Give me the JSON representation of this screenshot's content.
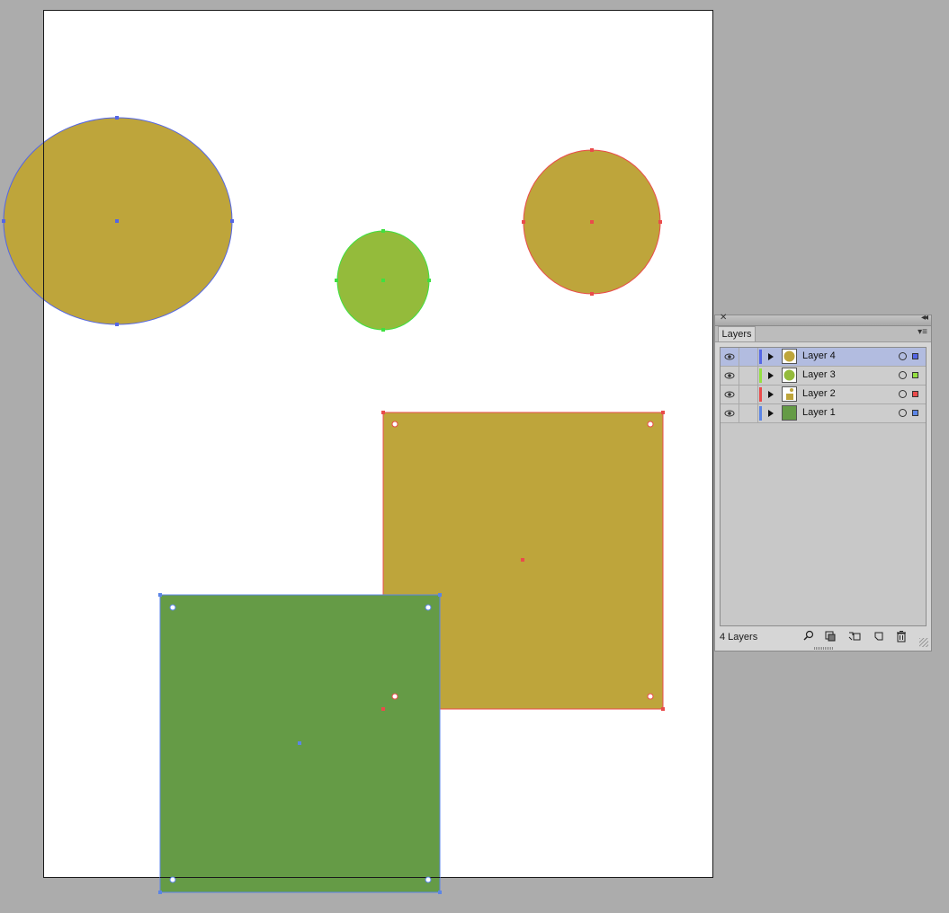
{
  "artwork": {
    "colors": {
      "mustard": "#bea53b",
      "lime": "#94bb3b",
      "green": "#659b46",
      "blue_handle": "#5466e6",
      "green_handle": "#40e040",
      "red_handle": "#ea4b4b",
      "steel_handle": "#5b85e6"
    }
  },
  "layers_panel": {
    "tab_label": "Layers",
    "close_glyph": "✕",
    "collapse_glyph": "◂◂",
    "menu_glyph": "▾≡",
    "layers": [
      {
        "name": "Layer 4",
        "color": "#5466e6",
        "thumb": "circle-mustard",
        "selected": true
      },
      {
        "name": "Layer 3",
        "color": "#94e040",
        "thumb": "circle-lime",
        "selected": false
      },
      {
        "name": "Layer 2",
        "color": "#ea4b4b",
        "thumb": "square-mustard",
        "selected": false
      },
      {
        "name": "Layer 1",
        "color": "#5b85e6",
        "thumb": "square-green",
        "selected": false
      }
    ],
    "footer": {
      "count_label": "4 Layers",
      "icons": [
        "search-icon",
        "clipping-mask-icon",
        "new-sublayer-icon",
        "new-layer-icon",
        "trash-icon"
      ]
    }
  }
}
